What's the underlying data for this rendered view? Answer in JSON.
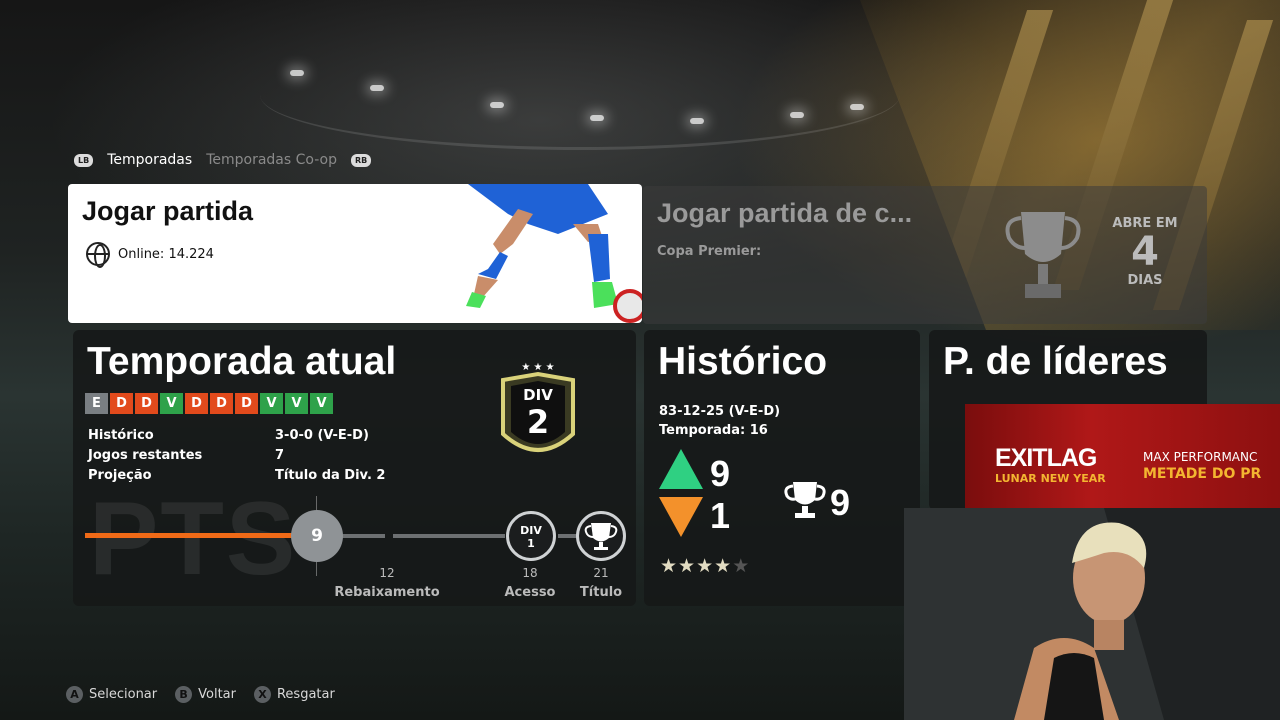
{
  "tabs": {
    "left_button": "LB",
    "right_button": "RB",
    "items": [
      "Temporadas",
      "Temporadas Co-op"
    ]
  },
  "play_card": {
    "title": "Jogar partida",
    "online_label": "Online: 14.224"
  },
  "copa_card": {
    "title": "Jogar partida de c...",
    "subtitle": "Copa Premier:",
    "opens_label": "ABRE EM",
    "opens_days": "4",
    "days_label": "DIAS"
  },
  "season": {
    "title": "Temporada atual",
    "results": [
      "E",
      "D",
      "D",
      "V",
      "D",
      "D",
      "D",
      "V",
      "V",
      "V"
    ],
    "stats": [
      {
        "label": "Histórico",
        "value": "3-0-0 (V-E-D)"
      },
      {
        "label": "Jogos restantes",
        "value": "7"
      },
      {
        "label": "Projeção",
        "value": "Título da Div. 2"
      }
    ],
    "division_label": "DIV",
    "division_number": "2",
    "pts_label": "PTS",
    "current_points": "9",
    "markers": [
      {
        "points": "12",
        "label": "Rebaixamento"
      },
      {
        "points": "18",
        "label": "Acesso"
      },
      {
        "points": "21",
        "label": "Título"
      }
    ],
    "div1_label": "DIV",
    "div1_number": "1",
    "colors": {
      "draw": "#7a7f83",
      "loss": "#e24a1c",
      "win": "#2ea24a",
      "progress": "#f06a17"
    }
  },
  "history": {
    "title": "Histórico",
    "record": "83-12-25 (V-E-D)",
    "season": "Temporada: 16",
    "promotions": "9",
    "relegations": "1",
    "titles": "9",
    "stars_filled": 4,
    "stars_total": 5
  },
  "leaders": {
    "title": "P. de líderes"
  },
  "ad": {
    "logo": "EXITLAG",
    "sub": "LUNAR NEW YEAR",
    "right_line1": "MAX PERFORMANC",
    "right_line2": "METADE DO PR"
  },
  "hints": [
    {
      "button": "A",
      "label": "Selecionar"
    },
    {
      "button": "B",
      "label": "Voltar"
    },
    {
      "button": "X",
      "label": "Resgatar"
    }
  ]
}
